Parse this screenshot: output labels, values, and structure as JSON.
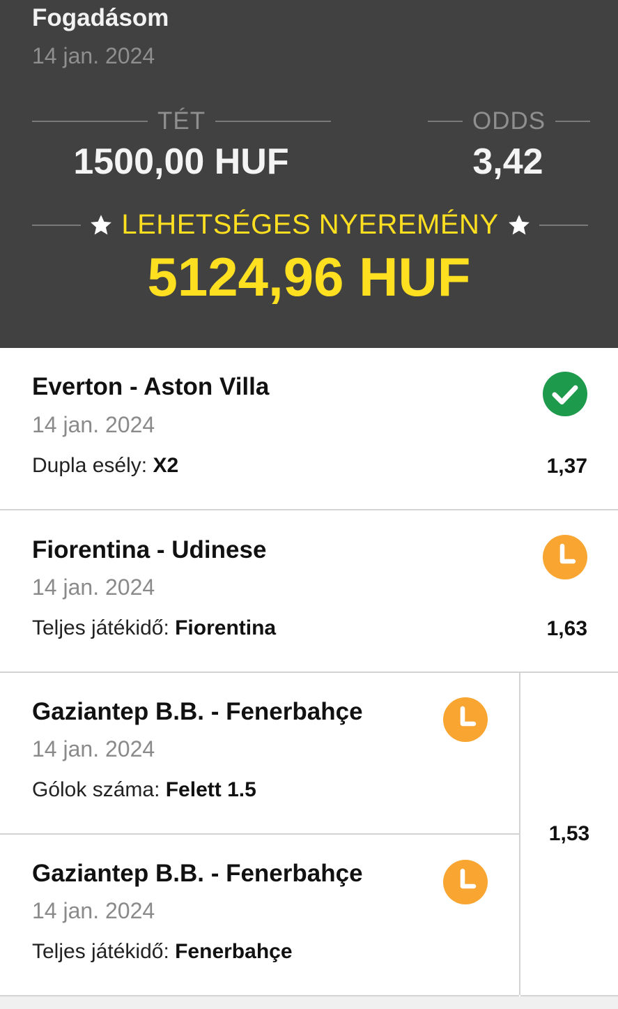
{
  "header": {
    "title": "Fogadásom",
    "date": "14 jan. 2024",
    "stake_label": "TÉT",
    "stake_value": "1500,00 HUF",
    "odds_label": "ODDS",
    "odds_value": "3,42",
    "win_label": "LEHETSÉGES NYEREMÉNY",
    "win_value": "5124,96 HUF"
  },
  "colors": {
    "header_bg": "#414141",
    "accent_yellow": "#ffe021",
    "won_green": "#1e9a4c",
    "pending_orange": "#f8a531"
  },
  "bets": [
    {
      "match": "Everton - Aston Villa",
      "date": "14 jan. 2024",
      "market": "Dupla esély: ",
      "pick": "X2",
      "odds": "1,37",
      "status_icon": "check-circle-icon"
    },
    {
      "match": "Fiorentina - Udinese",
      "date": "14 jan. 2024",
      "market": "Teljes játékidő: ",
      "pick": "Fiorentina",
      "odds": "1,63",
      "status_icon": "clock-icon"
    },
    {
      "match": "Gaziantep B.B. - Fenerbahçe",
      "date": "14 jan. 2024",
      "market": "Gólok száma: ",
      "pick": "Felett 1.5",
      "status_icon": "clock-icon"
    },
    {
      "match": "Gaziantep B.B. - Fenerbahçe",
      "date": "14 jan. 2024",
      "market": "Teljes játékidő: ",
      "pick": "Fenerbahçe",
      "status_icon": "clock-icon"
    }
  ],
  "combined_odds": "1,53"
}
